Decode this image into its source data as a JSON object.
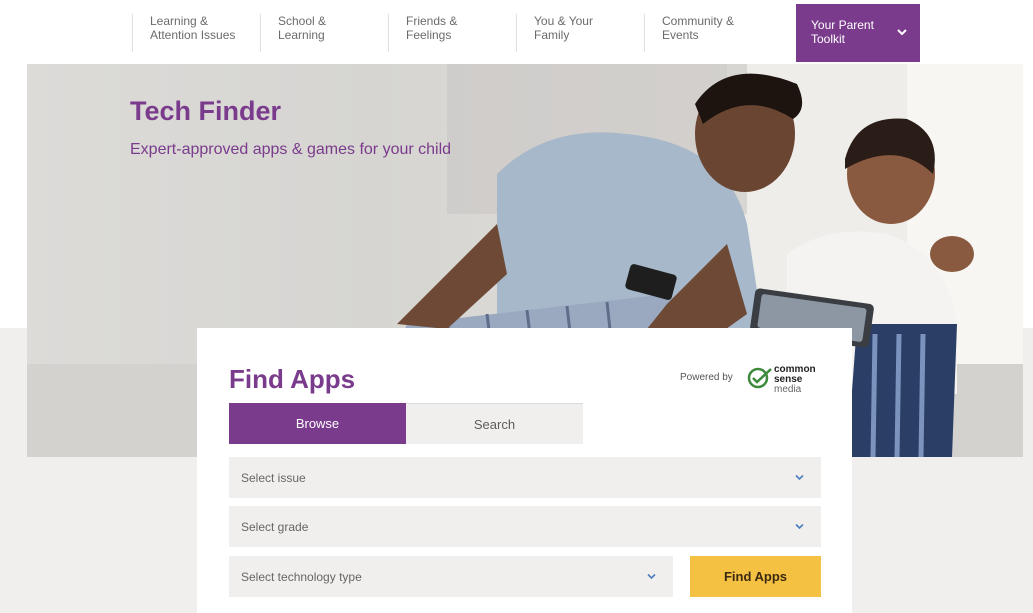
{
  "nav": {
    "items": [
      {
        "line1": "Learning &",
        "line2": "Attention Issues"
      },
      {
        "line1": "School &",
        "line2": "Learning"
      },
      {
        "line1": "Friends &",
        "line2": "Feelings"
      },
      {
        "line1": "You & Your",
        "line2": "Family"
      },
      {
        "line1": "Community &",
        "line2": "Events"
      }
    ],
    "toolkit": {
      "line1": "Your Parent",
      "line2": "Toolkit"
    }
  },
  "hero": {
    "title": "Tech Finder",
    "subtitle": "Expert-approved apps & games for your child"
  },
  "find_apps": {
    "title": "Find Apps",
    "powered_by": "Powered by",
    "logo": {
      "line1": "common",
      "line2": "sense",
      "line3": "media"
    },
    "tabs": {
      "browse": "Browse",
      "search": "Search"
    },
    "selects": {
      "issue": "Select issue",
      "grade": "Select grade",
      "technology": "Select technology type"
    },
    "button": "Find Apps"
  },
  "colors": {
    "brand_purple": "#7a3b8c",
    "button_yellow": "#f5c142",
    "panel_gray": "#f1efee",
    "logo_green": "#3d8a3d"
  },
  "icons": [
    "chevron-down-icon",
    "common-sense-check-icon"
  ]
}
